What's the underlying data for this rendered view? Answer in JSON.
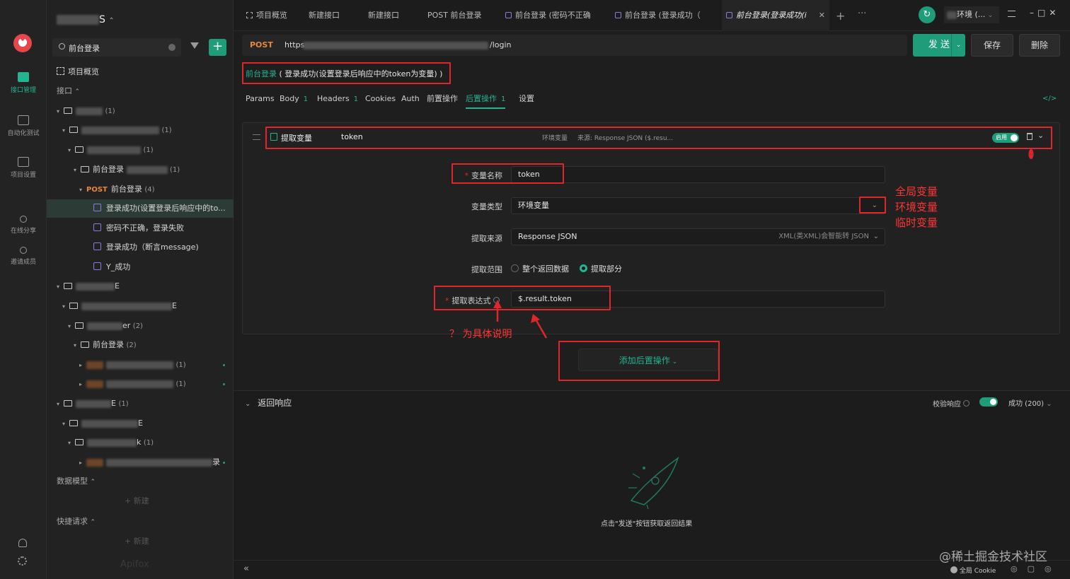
{
  "nav": [
    {
      "label": "接口管理",
      "active": true
    },
    {
      "label": "自动化测试"
    },
    {
      "label": "项目设置"
    },
    {
      "label": "在线分享"
    },
    {
      "label": "邀请成员"
    }
  ],
  "sidebar": {
    "project_name": "S",
    "search_value": "前台登录",
    "overview_label": "项目概览",
    "interfaces_label": "接口",
    "rows": [
      {
        "type": "folder",
        "label": "",
        "count": "(1)"
      },
      {
        "type": "folder",
        "label": "",
        "count": "(1)"
      },
      {
        "type": "folder",
        "label": "",
        "count": "(1)"
      },
      {
        "type": "folder",
        "label": "前台登录",
        "count": "(1)"
      },
      {
        "type": "api",
        "method": "POST",
        "label": "前台登录",
        "count": "(4)"
      },
      {
        "type": "case",
        "label": "登录成功(设置登录后响应中的to..."
      },
      {
        "type": "case",
        "label": "密码不正确，登录失败"
      },
      {
        "type": "case",
        "label": "登录成功（断言message)"
      },
      {
        "type": "case",
        "label": "Y_成功"
      },
      {
        "type": "folder",
        "label": "E",
        "count": ""
      },
      {
        "type": "folder",
        "label": "E",
        "count": ""
      },
      {
        "type": "folder",
        "label": "er",
        "count": "(2)"
      },
      {
        "type": "folder",
        "label": "前台登录",
        "count": "(2)"
      },
      {
        "type": "item",
        "label": "",
        "count": "(1)"
      },
      {
        "type": "item",
        "label": "",
        "count": "(1)"
      },
      {
        "type": "folder",
        "label": "E",
        "count": "(1)"
      },
      {
        "type": "folder",
        "label": "E",
        "count": ""
      },
      {
        "type": "folder",
        "label": "k",
        "count": "(1)"
      },
      {
        "type": "item",
        "label": "录",
        "count": ""
      }
    ],
    "data_model_label": "数据模型",
    "quick_request_label": "快捷请求",
    "new_label": "+ 新建",
    "brand": "Apifox"
  },
  "tabs": [
    {
      "label": "项目概览"
    },
    {
      "label": "新建接口"
    },
    {
      "label": "新建接口"
    },
    {
      "label": "POST 前台登录"
    },
    {
      "label": "前台登录 (密码不正确"
    },
    {
      "label": "前台登录 (登录成功（"
    },
    {
      "label": "前台登录(登录成功(i",
      "active": true
    }
  ],
  "env_label": "环境 (...",
  "request": {
    "method": "POST",
    "url_prefix": "https",
    "url_suffix": "/login",
    "send_label": "发 送",
    "save_label": "保存",
    "delete_label": "删除",
    "breadcrumb_name": "前台登录",
    "breadcrumb_desc": "( 登录成功(设置登录后响应中的token为变量) )"
  },
  "subtabs": [
    {
      "label": "Params",
      "num": ""
    },
    {
      "label": "Body",
      "num": "1"
    },
    {
      "label": "Headers",
      "num": "1"
    },
    {
      "label": "Cookies",
      "num": ""
    },
    {
      "label": "Auth",
      "num": ""
    },
    {
      "label": "前置操作",
      "num": ""
    },
    {
      "label": "后置操作",
      "num": "1",
      "active": true
    },
    {
      "label": "设置",
      "num": ""
    }
  ],
  "extract": {
    "title": "提取变量",
    "var_summary": "token",
    "env_tag": "环境变量",
    "source_tag": "来源: Response JSON ($.resu...",
    "enabled_label": "启用",
    "name_label": "变量名称",
    "name_value": "token",
    "type_label": "变量类型",
    "type_value": "环境变量",
    "source_label": "提取来源",
    "source_value": "Response JSON",
    "source_hint": "XML(类XML)会智能转 JSON",
    "range_label": "提取范围",
    "range_all": "整个返回数据",
    "range_part": "提取部分",
    "expr_label": "提取表达式",
    "expr_value": "$.result.token"
  },
  "add_post_op": "添加后置操作",
  "annotations": {
    "var_types": [
      "全局变量",
      "环境变量",
      "临时变量"
    ],
    "question_note": "？ 为具体说明"
  },
  "response": {
    "title": "返回响应",
    "validate_label": "校验响应",
    "status": "成功 (200)",
    "empty_hint": "点击\"发送\"按钮获取返回结果"
  },
  "footer": {
    "cookie_label": "全局 Cookie",
    "watermark": "@稀土掘金技术社区"
  }
}
